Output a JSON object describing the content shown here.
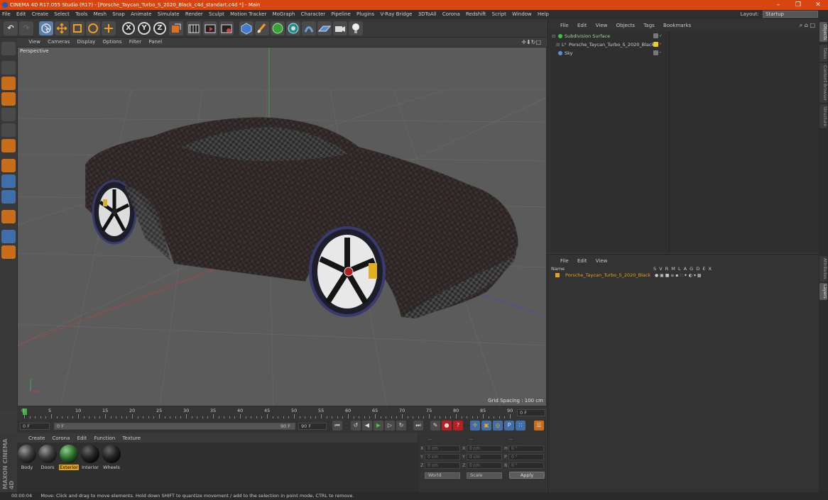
{
  "window": {
    "title": "CINEMA 4D R17.055 Studio (R17) - [Porsche_Taycan_Turbo_S_2020_Black_c4d_standart.c4d *] - Main",
    "controls": [
      "–",
      "❐",
      "✕"
    ]
  },
  "menubar": {
    "items": [
      "File",
      "Edit",
      "Create",
      "Select",
      "Tools",
      "Mesh",
      "Snap",
      "Animate",
      "Simulate",
      "Render",
      "Sculpt",
      "Motion Tracker",
      "MoGraph",
      "Character",
      "Pipeline",
      "Plugins",
      "V-Ray Bridge",
      "3DToAll",
      "Corona",
      "Redshift",
      "Script",
      "Window",
      "Help"
    ],
    "layout_label": "Layout:",
    "layout_value": "Startup"
  },
  "toolbar": {
    "undo_icon": "↶",
    "redo_icon": "↷",
    "axis_x": "X",
    "axis_y": "Y",
    "axis_z": "Z"
  },
  "viewport": {
    "menu": [
      "View",
      "Cameras",
      "Display",
      "Options",
      "Filter",
      "Panel"
    ],
    "label": "Perspective",
    "grid_spacing": "Grid Spacing : 100 cm",
    "nav_icons": "✛⬇↻□"
  },
  "timeline": {
    "ticks": [
      "0",
      "5",
      "10",
      "15",
      "20",
      "25",
      "30",
      "35",
      "40",
      "45",
      "50",
      "55",
      "60",
      "65",
      "70",
      "75",
      "80",
      "85",
      "90"
    ],
    "current_frame": "0 F"
  },
  "controls": {
    "start_frame": "0 F",
    "preview_min": "0 F",
    "preview_max": "90 F",
    "end_frame": "90 F"
  },
  "materials": {
    "menu": [
      "Create",
      "Corona",
      "Edit",
      "Function",
      "Texture"
    ],
    "items": [
      {
        "name": "Body"
      },
      {
        "name": "Doors"
      },
      {
        "name": "Exterior"
      },
      {
        "name": "Interior"
      },
      {
        "name": "Wheels"
      }
    ]
  },
  "coordinates": {
    "header": [
      "--",
      "--",
      "--"
    ],
    "rows": [
      {
        "axis": "X",
        "pos": "0 cm",
        "size_axis": "X",
        "size": "0 cm",
        "rot_axis": "H",
        "rot": "0 °"
      },
      {
        "axis": "Y",
        "pos": "0 cm",
        "size_axis": "Y",
        "size": "0 cm",
        "rot_axis": "P",
        "rot": "0 °"
      },
      {
        "axis": "Z",
        "pos": "0 cm",
        "size_axis": "Z",
        "size": "0 cm",
        "rot_axis": "B",
        "rot": "0 °"
      }
    ],
    "mode": "World",
    "scale_mode": "Scale",
    "apply": "Apply"
  },
  "objects": {
    "menu": [
      "File",
      "Edit",
      "View",
      "Objects",
      "Tags",
      "Bookmarks"
    ],
    "items": [
      {
        "name": "Subdivision Surface",
        "color": "#45c045"
      },
      {
        "name": "Porsche_Taycan_Turbo_S_2020_Black",
        "color": "#c8c8c8"
      },
      {
        "name": "Sky",
        "color": "#5b8fd8"
      }
    ]
  },
  "layers": {
    "menu": [
      "File",
      "Edit",
      "View"
    ],
    "header_name": "Name",
    "header_cols": "S V R M L A G D E X",
    "row_name": "Porsche_Taycan_Turbo_S_2020_Black",
    "accent": "#e6a21a"
  },
  "right_tabs": [
    "Objects",
    "Takes",
    "Content Browser",
    "Structure",
    "Attributes",
    "Layers"
  ],
  "status": {
    "time": "00:00:04",
    "message": "Move: Click and drag to move elements. Hold down SHIFT to quantize movement / add to the selection in point mode, CTRL to remove."
  },
  "brand": "MAXON CINEMA 4D"
}
